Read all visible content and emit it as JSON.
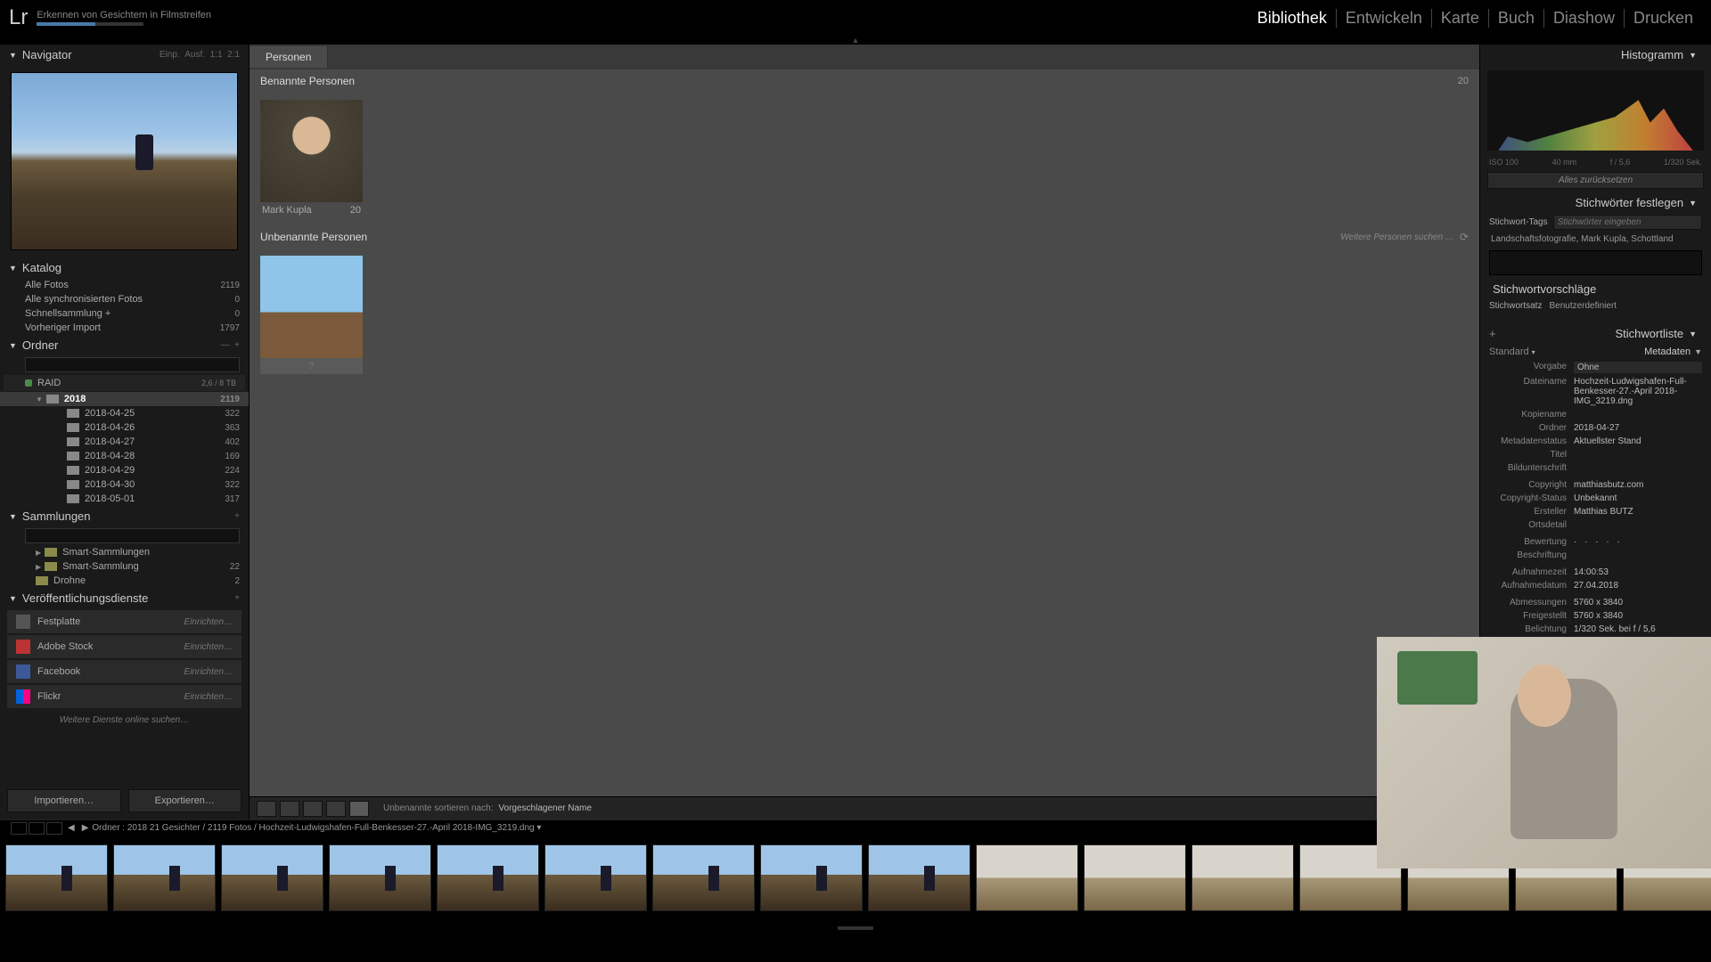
{
  "header": {
    "app": "Lr",
    "title": "Erkennen von Gesichtern in Filmstreifen",
    "modules": [
      "Bibliothek",
      "Entwickeln",
      "Karte",
      "Buch",
      "Diashow",
      "Drucken"
    ],
    "active_module": "Bibliothek"
  },
  "navigator": {
    "title": "Navigator",
    "fit": "Einp.",
    "fill": "Ausf.",
    "zoom1": "1:1",
    "zoom2": "2:1"
  },
  "catalog": {
    "title": "Katalog",
    "items": [
      {
        "label": "Alle Fotos",
        "count": "2119"
      },
      {
        "label": "Alle synchronisierten Fotos",
        "count": "0"
      },
      {
        "label": "Schnellsammlung  +",
        "count": "0"
      },
      {
        "label": "Vorheriger Import",
        "count": "1797"
      }
    ]
  },
  "folders": {
    "title": "Ordner",
    "volume": "RAID",
    "volume_info": "2,6 / 8 TB",
    "tree": {
      "root": {
        "label": "2018",
        "count": "2119"
      },
      "children": [
        {
          "label": "2018-04-25",
          "count": "322"
        },
        {
          "label": "2018-04-26",
          "count": "363"
        },
        {
          "label": "2018-04-27",
          "count": "402"
        },
        {
          "label": "2018-04-28",
          "count": "169"
        },
        {
          "label": "2018-04-29",
          "count": "224"
        },
        {
          "label": "2018-04-30",
          "count": "322"
        },
        {
          "label": "2018-05-01",
          "count": "317"
        }
      ]
    }
  },
  "collections": {
    "title": "Sammlungen",
    "items": [
      {
        "label": "Smart-Sammlungen",
        "count": ""
      },
      {
        "label": "Smart-Sammlung",
        "count": "22"
      },
      {
        "label": "Drohne",
        "count": "2"
      }
    ]
  },
  "publish": {
    "title": "Veröffentlichungsdienste",
    "items": [
      {
        "label": "Festplatte",
        "setup": "Einrichten…"
      },
      {
        "label": "Adobe Stock",
        "setup": "Einrichten…"
      },
      {
        "label": "Facebook",
        "setup": "Einrichten…"
      },
      {
        "label": "Flickr",
        "setup": "Einrichten…"
      }
    ],
    "more": "Weitere Dienste online suchen…"
  },
  "left_buttons": {
    "import": "Importieren…",
    "export": "Exportieren…"
  },
  "center": {
    "tab": "Personen",
    "named_title": "Benannte Personen",
    "named_count": "20",
    "named": {
      "name": "Mark Kupla",
      "count": "20"
    },
    "unnamed_title": "Unbenannte Personen",
    "unnamed_more": "Weitere Personen suchen …",
    "unnamed_placeholder": "?",
    "toolbar": {
      "sort_label": "Unbenannte sortieren nach:",
      "sort_value": "Vorgeschlagener Name"
    }
  },
  "right": {
    "histogram_title": "Histogramm",
    "histo_iso": "ISO 100",
    "histo_focal": "40 mm",
    "histo_aperture": "f / 5,6",
    "histo_shutter": "1/320 Sek.",
    "reset": "Alles zurücksetzen",
    "kw_panel": "Stichwörter festlegen",
    "kw_tags": "Stichwort-Tags",
    "kw_placeholder": "Stichwörter eingeben",
    "kw_list": "Landschaftsfotografie, Mark Kupla, Schottland",
    "kw_sugg_title": "Stichwortvorschläge",
    "kw_set_label": "Stichwortsatz",
    "kw_set_val": "Benutzerdefiniert",
    "kw_list_title": "Stichwortliste",
    "meta_panel": "Metadaten",
    "meta_mode": "Standard",
    "preset_label": "Vorgabe",
    "preset_val": "Ohne",
    "rows": [
      {
        "l": "Dateiname",
        "v": "Hochzeit-Ludwigshafen-Full-Benkesser-27.-April 2018-IMG_3219.dng"
      },
      {
        "l": "Kopiename",
        "v": ""
      },
      {
        "l": "Ordner",
        "v": "2018-04-27"
      },
      {
        "l": "Metadatenstatus",
        "v": "Aktuellster Stand"
      },
      {
        "l": "Titel",
        "v": ""
      },
      {
        "l": "Bildunterschrift",
        "v": ""
      },
      {
        "l": "Copyright",
        "v": "matthiasbutz.com"
      },
      {
        "l": "Copyright-Status",
        "v": "Unbekannt"
      },
      {
        "l": "Ersteller",
        "v": "Matthias BUTZ"
      },
      {
        "l": "Ortsdetail",
        "v": ""
      },
      {
        "l": "Bewertung",
        "v": "·  ·  ·  ·  ·"
      },
      {
        "l": "Beschriftung",
        "v": ""
      },
      {
        "l": "Aufnahmezeit",
        "v": "14:00:53"
      },
      {
        "l": "Aufnahmedatum",
        "v": "27.04.2018"
      },
      {
        "l": "Abmessungen",
        "v": "5760 x 3840"
      },
      {
        "l": "Freigestellt",
        "v": "5760 x 3840"
      },
      {
        "l": "Belichtung",
        "v": "1/320 Sek. bei f / 5,6"
      }
    ]
  },
  "status": {
    "path": "Ordner : 2018    21 Gesichter / 2119 Fotos / Hochzeit-Ludwigshafen-Full-Benkesser-27.-April 2018-IMG_3219.dng  ▾"
  }
}
